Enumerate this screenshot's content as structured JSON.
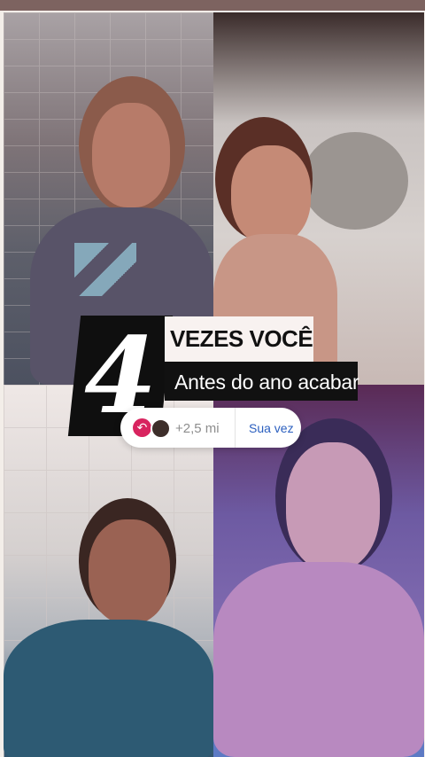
{
  "colors": {
    "top_bar": "#7d6360",
    "sticker_black": "#111111",
    "sticker_white": "#f8f2f0",
    "accent_pink": "#d8245f",
    "accent_blue": "#2b5fbf"
  },
  "sticker": {
    "number": "4",
    "line1": "VEZES VOCÊ",
    "line2": "Antes do ano acabar"
  },
  "add_yours": {
    "count": "+2,5 mi",
    "action": "Sua vez",
    "reply_icon": "reply-arrow-icon",
    "avatar_icon": "participant-avatar"
  },
  "photos": [
    {
      "name": "photo-top-left"
    },
    {
      "name": "photo-top-right"
    },
    {
      "name": "photo-bottom-left"
    },
    {
      "name": "photo-bottom-right"
    }
  ]
}
